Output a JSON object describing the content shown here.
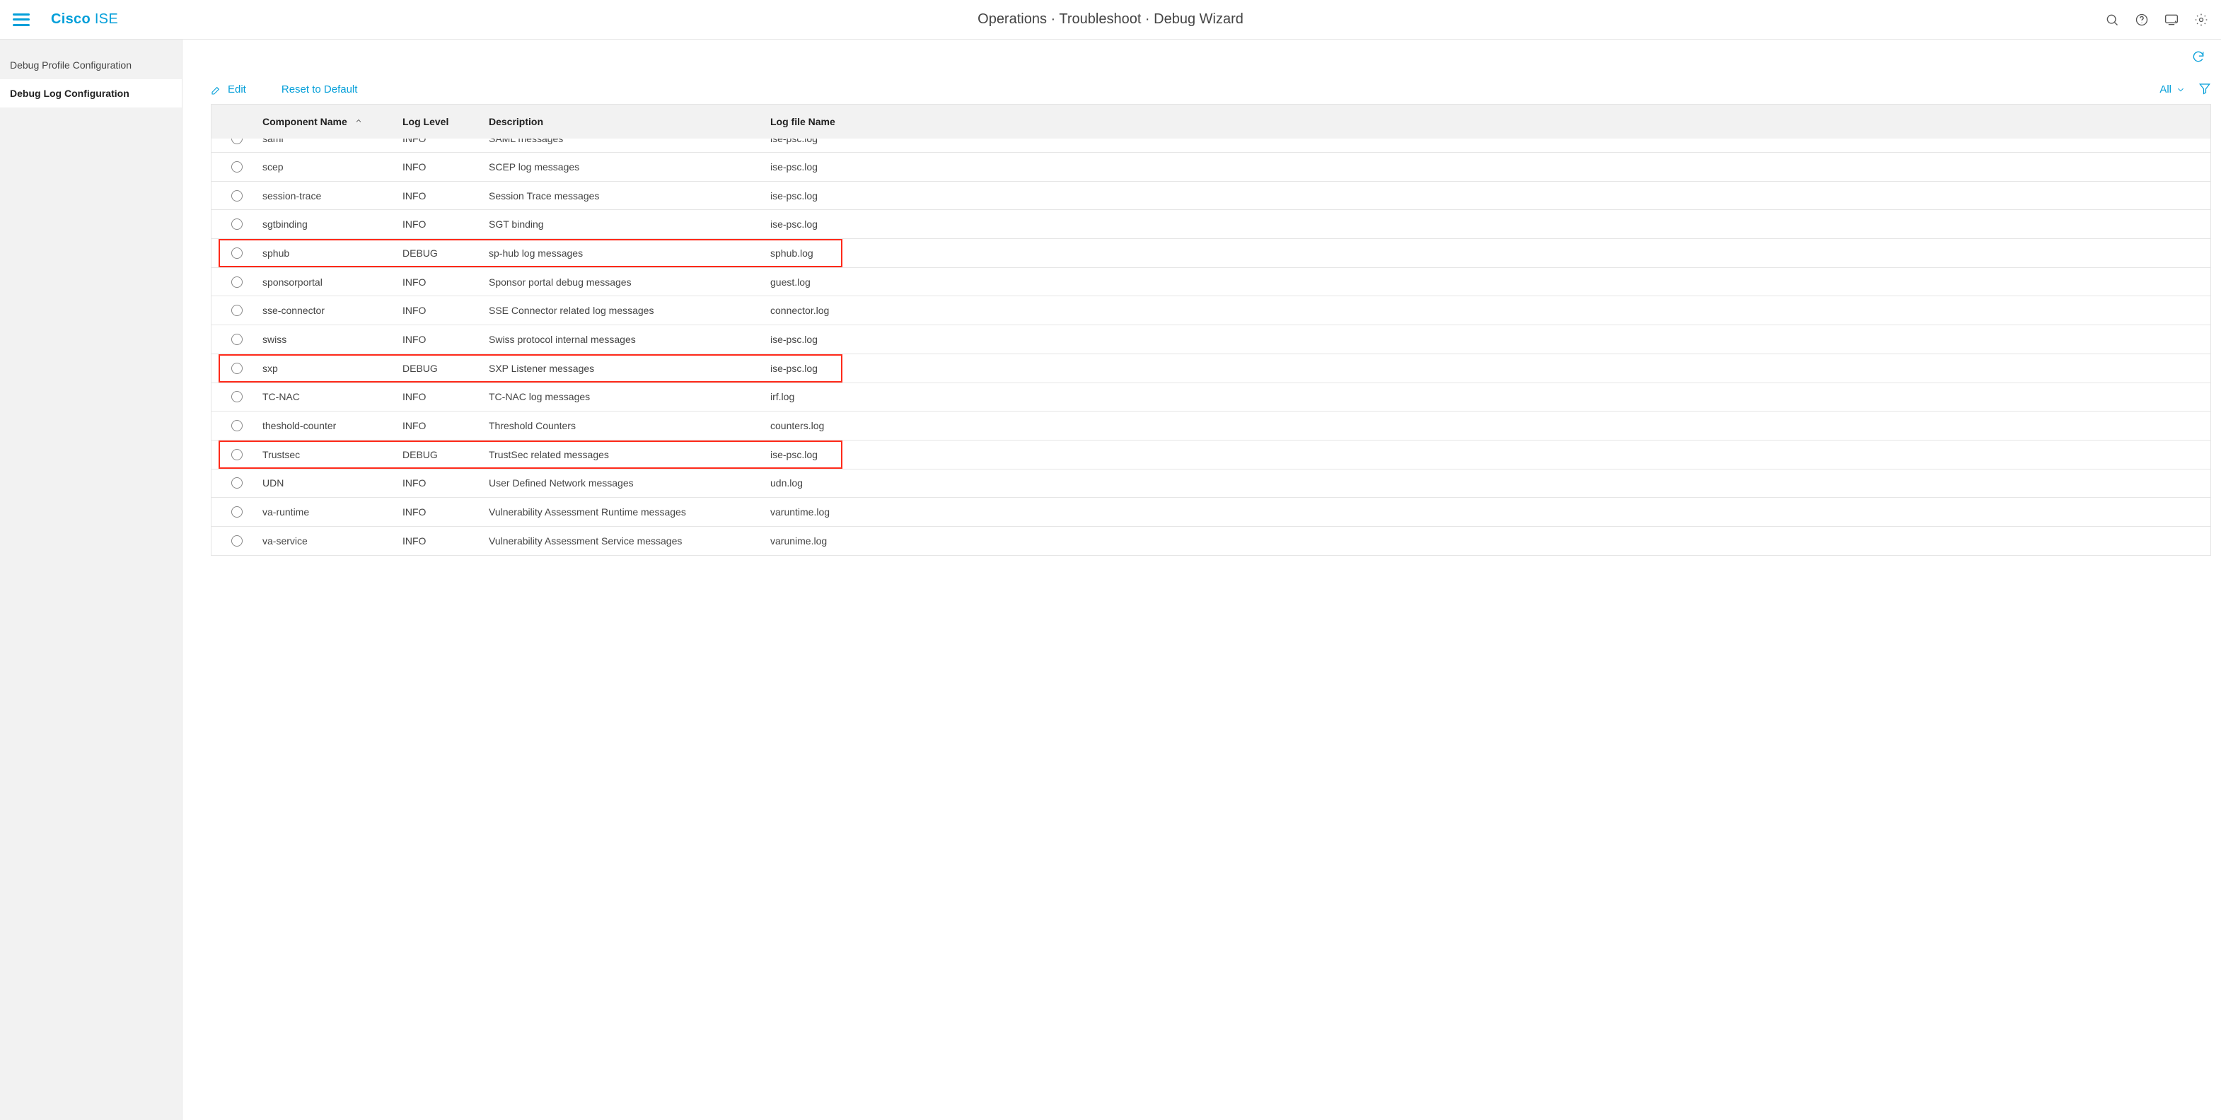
{
  "header": {
    "brand_cisco": "Cisco",
    "brand_ise": "ISE",
    "breadcrumb": "Operations · Troubleshoot · Debug Wizard"
  },
  "sidebar": {
    "items": [
      {
        "label": "Debug Profile Configuration",
        "active": false
      },
      {
        "label": "Debug Log Configuration",
        "active": true
      }
    ]
  },
  "toolbar": {
    "edit_label": "Edit",
    "reset_label": "Reset to Default",
    "filter_all_label": "All"
  },
  "table": {
    "columns": {
      "component": "Component Name",
      "level": "Log Level",
      "description": "Description",
      "file": "Log file Name"
    },
    "rows": [
      {
        "component": "saml",
        "level": "INFO",
        "description": "SAML messages",
        "file": "ise-psc.log",
        "highlight": false,
        "cutTop": true
      },
      {
        "component": "scep",
        "level": "INFO",
        "description": "SCEP log messages",
        "file": "ise-psc.log",
        "highlight": false
      },
      {
        "component": "session-trace",
        "level": "INFO",
        "description": "Session Trace messages",
        "file": "ise-psc.log",
        "highlight": false
      },
      {
        "component": "sgtbinding",
        "level": "INFO",
        "description": "SGT binding",
        "file": "ise-psc.log",
        "highlight": false
      },
      {
        "component": "sphub",
        "level": "DEBUG",
        "description": "sp-hub log messages",
        "file": "sphub.log",
        "highlight": true
      },
      {
        "component": "sponsorportal",
        "level": "INFO",
        "description": "Sponsor portal debug messages",
        "file": "guest.log",
        "highlight": false
      },
      {
        "component": "sse-connector",
        "level": "INFO",
        "description": "SSE Connector related log messages",
        "file": "connector.log",
        "highlight": false
      },
      {
        "component": "swiss",
        "level": "INFO",
        "description": "Swiss protocol internal messages",
        "file": "ise-psc.log",
        "highlight": false
      },
      {
        "component": "sxp",
        "level": "DEBUG",
        "description": "SXP Listener messages",
        "file": "ise-psc.log",
        "highlight": true
      },
      {
        "component": "TC-NAC",
        "level": "INFO",
        "description": "TC-NAC log messages",
        "file": "irf.log",
        "highlight": false
      },
      {
        "component": "theshold-counter",
        "level": "INFO",
        "description": "Threshold Counters",
        "file": "counters.log",
        "highlight": false
      },
      {
        "component": "Trustsec",
        "level": "DEBUG",
        "description": "TrustSec related messages",
        "file": "ise-psc.log",
        "highlight": true
      },
      {
        "component": "UDN",
        "level": "INFO",
        "description": "User Defined Network messages",
        "file": "udn.log",
        "highlight": false
      },
      {
        "component": "va-runtime",
        "level": "INFO",
        "description": "Vulnerability Assessment Runtime messages",
        "file": "varuntime.log",
        "highlight": false
      },
      {
        "component": "va-service",
        "level": "INFO",
        "description": "Vulnerability Assessment Service messages",
        "file": "varunime.log",
        "highlight": false
      }
    ]
  }
}
